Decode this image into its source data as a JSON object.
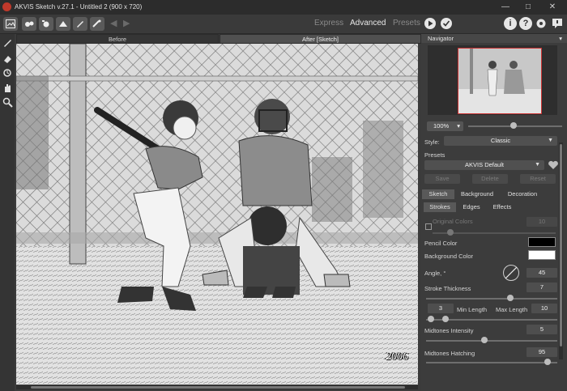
{
  "window": {
    "title": "AKVIS Sketch v.27.1 - Untitled 2 (900 x 720)",
    "minimize": "—",
    "maximize": "□",
    "close": "✕"
  },
  "toolbar": {
    "modes": [
      "Express",
      "Advanced",
      "Presets"
    ],
    "active_mode": "Advanced",
    "accent": "#e6e6e6"
  },
  "canvas": {
    "tabs": [
      "Before",
      "After [Sketch]"
    ],
    "active_tab": "After [Sketch]",
    "watermark_year": "2006"
  },
  "navigator": {
    "heading": "Navigator",
    "zoom": "100%",
    "zoom_level": 0.7
  },
  "settings": {
    "style_label": "Style:",
    "style_value": "Classic",
    "presets_label": "Presets",
    "preset_value": "AKVIS Default",
    "save": "Save",
    "delete": "Delete",
    "reset": "Reset",
    "tabs": [
      "Sketch",
      "Background",
      "Decoration"
    ],
    "active_tab": "Sketch",
    "subtabs": [
      "Strokes",
      "Edges",
      "Effects"
    ],
    "active_subtab": "Strokes",
    "original_colors_label": "Original Colors",
    "original_colors_value": "10",
    "pencil_color_label": "Pencil Color",
    "pencil_color": "#000000",
    "background_color_label": "Background Color",
    "background_color": "#ffffff",
    "angle_label": "Angle, °",
    "angle_value": "45",
    "stroke_thickness_label": "Stroke Thickness",
    "stroke_thickness_value": "7",
    "min_length_value": "3",
    "min_length_label": "Min Length",
    "max_length_label": "Max Length",
    "max_length_value": "10",
    "midtones_intensity_label": "Midtones Intensity",
    "midtones_intensity_value": "5",
    "midtones_hatching_label": "Midtones Hatching",
    "midtones_hatching_value": "95"
  }
}
